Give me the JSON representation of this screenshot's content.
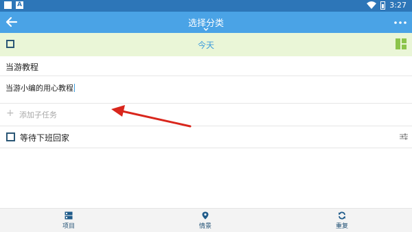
{
  "status_bar": {
    "time": "3:27",
    "left_icons": [
      "notification-square-icon",
      "a-notification-icon"
    ],
    "right_icons": [
      "wifi-icon",
      "battery-icon"
    ]
  },
  "app_bar": {
    "title": "选择分类",
    "back_icon": "arrow-left-icon",
    "menu_icon": "more-dots-icon",
    "color": "#4aa3e6"
  },
  "today_row": {
    "label": "今天",
    "background": "#eaf6d7",
    "board_icon": "board-view-icon"
  },
  "task": {
    "title": "当游教程",
    "note": "当游小编的用心教程",
    "add_subtask_placeholder": "添加子任务"
  },
  "tasks": [
    {
      "label": "等待下班回家",
      "icon": "sliders-icon"
    }
  ],
  "bottom_nav": [
    {
      "label": "项目",
      "icon": "project-list-icon"
    },
    {
      "label": "情景",
      "icon": "location-pin-icon"
    },
    {
      "label": "重复",
      "icon": "repeat-icon"
    }
  ],
  "annotation": {
    "color": "#d9261c"
  }
}
